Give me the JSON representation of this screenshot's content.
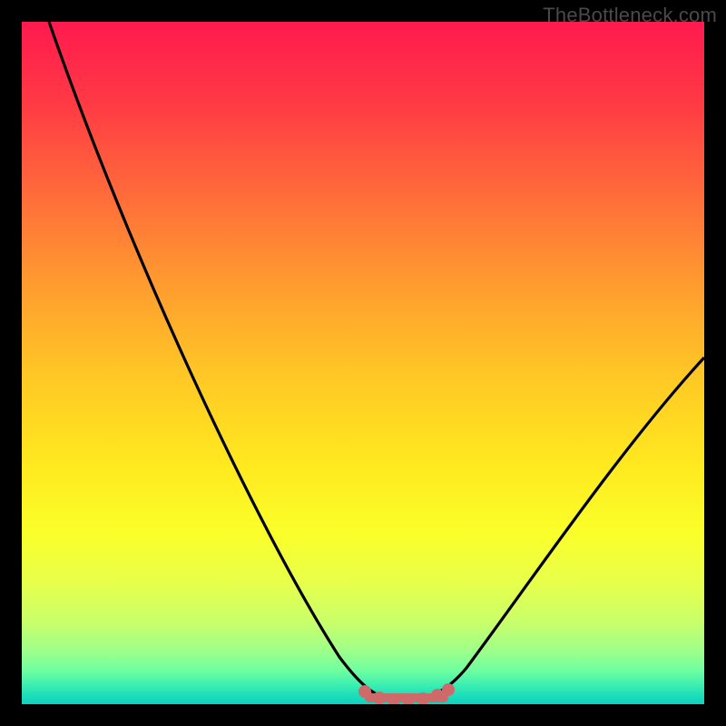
{
  "watermark": {
    "text": "TheBottleneck.com"
  },
  "colors": {
    "frame": "#000000",
    "curve_stroke": "#000000",
    "marker_fill": "#cf6a6a"
  },
  "chart_data": {
    "type": "line",
    "title": "",
    "xlabel": "",
    "ylabel": "",
    "xlim": [
      0,
      100
    ],
    "ylim": [
      0,
      100
    ],
    "grid": false,
    "series": [
      {
        "name": "bottleneck-curve",
        "x": [
          4,
          10,
          20,
          30,
          40,
          46,
          50,
          53,
          56,
          60,
          64,
          68,
          75,
          85,
          98
        ],
        "values": [
          100,
          84,
          60,
          40,
          22,
          10,
          3,
          0,
          0,
          0,
          3,
          10,
          22,
          38,
          56
        ]
      }
    ],
    "markers": {
      "name": "flat-region",
      "x": [
        50,
        53,
        56,
        58,
        60,
        62
      ],
      "values": [
        0.5,
        0,
        0,
        0,
        0,
        0.5
      ]
    }
  }
}
